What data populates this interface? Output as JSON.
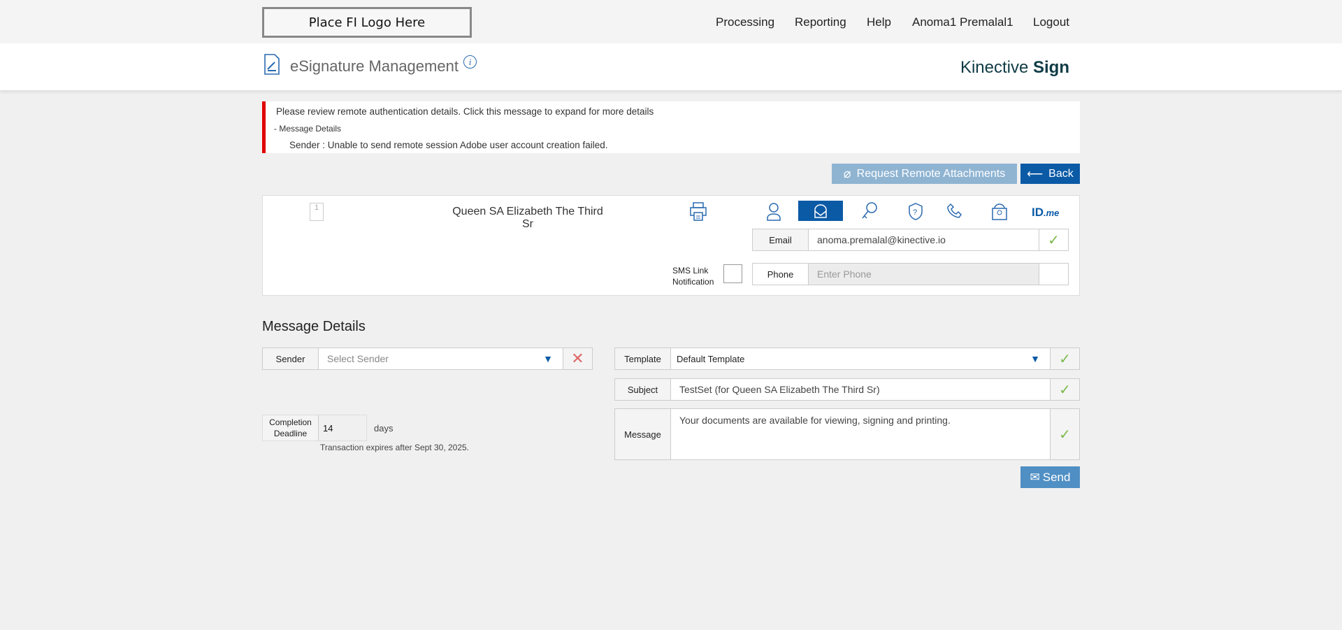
{
  "header": {
    "logo": "Place FI Logo Here",
    "nav": [
      "Processing",
      "Reporting",
      "Help",
      "Anoma1 Premalal1",
      "Logout"
    ]
  },
  "band": {
    "title": "eSignature Management",
    "info": "i",
    "brand_light": "Kinective",
    "brand_bold": "Sign"
  },
  "alert": {
    "headline": "Please review remote authentication details. Click this message to expand for more details",
    "toggle": "- Message Details",
    "detail": "Sender :  Unable to send remote session Adobe user account creation failed.",
    "color": "#e00000"
  },
  "actions": {
    "attachments": "Request Remote Attachments",
    "back": "Back"
  },
  "recipient": {
    "doc_count": "1",
    "name": "Queen SA Elizabeth The Third Sr",
    "auth_methods": [
      "person-icon",
      "email-icon",
      "key-icon",
      "shield-question-icon",
      "phone-icon",
      "id-card-icon",
      "idme-icon"
    ],
    "active_method": "email-icon",
    "idme": "ID",
    "idme_suffix": ".me",
    "email_label": "Email",
    "email_value": "anoma.premalal@kinective.io",
    "sms_label": "SMS Link Notification",
    "sms_checked": false,
    "phone_label": "Phone",
    "phone_placeholder": "Enter Phone"
  },
  "message": {
    "heading": "Message Details",
    "sender_label": "Sender",
    "sender_placeholder": "Select Sender",
    "template_label": "Template",
    "template_value": "Default Template",
    "subject_label": "Subject",
    "subject_value": "TestSet (for Queen SA Elizabeth The Third Sr)",
    "message_label": "Message",
    "message_value": "Your documents are available for viewing, signing and printing.",
    "deadline_label": "Completion Deadline",
    "deadline_value": "14",
    "deadline_unit": "days",
    "expires": "Transaction expires after Sept 30, 2025.",
    "send": "Send"
  },
  "colors": {
    "primary": "#0b5aa6",
    "disabled": "#8fb4d2",
    "send": "#4f8fc4",
    "check": "#7bb84a"
  }
}
